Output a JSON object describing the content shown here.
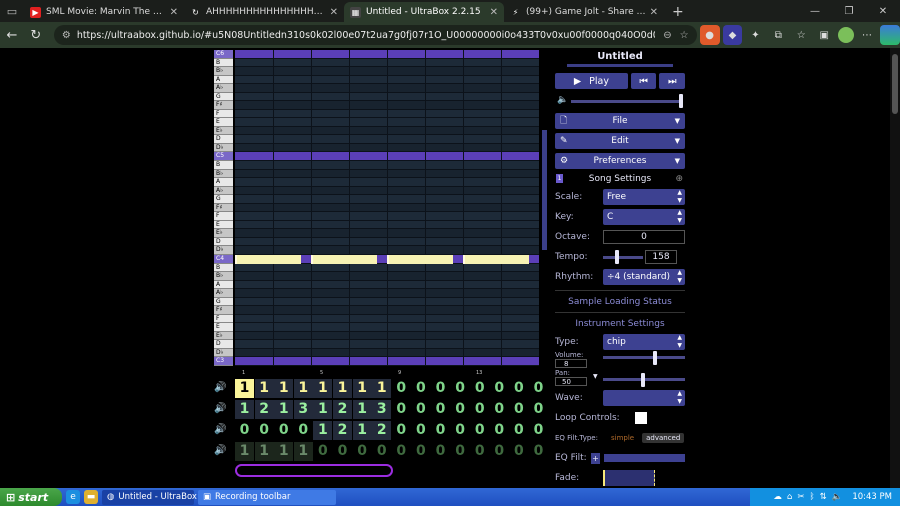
{
  "browser": {
    "tabs": [
      {
        "title": "SML Movie: Marvin The Hero! - Y",
        "fav_color": "#e02020",
        "fav_glyph": "▶",
        "active": false
      },
      {
        "title": "AHHHHHHHHHHHHHHHHHHHHH",
        "fav_color": "#1b1e1b",
        "fav_glyph": "↻",
        "active": false
      },
      {
        "title": "Untitled - UltraBox 2.2.15",
        "fav_color": "#444",
        "fav_glyph": "▦",
        "active": true
      },
      {
        "title": "(99+) Game Jolt - Share your cre",
        "fav_color": "#1b1e1b",
        "fav_glyph": "⚡",
        "active": false
      }
    ],
    "url": "https://ultraabox.github.io/#u5N08Untitledn310s0k02l00e07t2ua7g0fj07r1O_U00000000i0o433T0v0xu00f0000q040O0d030wp1h0y00..."
  },
  "song": {
    "title": "Untitled",
    "play_label": "Play",
    "menus": {
      "file": "File",
      "edit": "Edit",
      "preferences": "Preferences"
    },
    "song_settings_label": "Song Settings",
    "scale_label": "Scale:",
    "scale_value": "Free",
    "key_label": "Key:",
    "key_value": "C",
    "octave_label": "Octave:",
    "octave_value": "0",
    "tempo_label": "Tempo:",
    "tempo_value": "158",
    "rhythm_label": "Rhythm:",
    "rhythm_value": "÷4 (standard)",
    "sample_status": "Sample Loading Status",
    "instrument_settings": "Instrument Settings",
    "type_label": "Type:",
    "type_value": "chip",
    "volume_label": "Volume:",
    "volume_value": "8",
    "pan_label": "Pan:",
    "pan_value": "50",
    "wave_label": "Wave:",
    "loop_label": "Loop Controls:",
    "eq_type_label": "EQ Filt.Type:",
    "eq_simple": "simple",
    "eq_advanced": "advanced",
    "eq_filt_label": "EQ Filt:",
    "fade_label": "Fade:"
  },
  "piano_keys": [
    "C6",
    "B",
    "B♭",
    "A",
    "A♭",
    "G",
    "F♯",
    "F",
    "E",
    "E♭",
    "D",
    "D♭",
    "C5",
    "B",
    "B♭",
    "A",
    "A♭",
    "G",
    "F♯",
    "F",
    "E",
    "E♭",
    "D",
    "D♭",
    "C4",
    "B",
    "B♭",
    "A",
    "A♭",
    "G",
    "F♯",
    "F",
    "E",
    "E♭",
    "D",
    "D♭",
    "C3"
  ],
  "bar_numbers": [
    "1",
    "",
    "",
    "",
    "5",
    "",
    "",
    "",
    "9",
    "",
    "",
    "",
    "13"
  ],
  "tracks": [
    {
      "cells": [
        "1",
        "1",
        "1",
        "1",
        "1",
        "1",
        "1",
        "1",
        "0",
        "0",
        "0",
        "0",
        "0",
        "0",
        "0",
        "0"
      ],
      "color": "#fbf59a",
      "selected": 0
    },
    {
      "cells": [
        "1",
        "2",
        "1",
        "3",
        "1",
        "2",
        "1",
        "3",
        "0",
        "0",
        "0",
        "0",
        "0",
        "0",
        "0",
        "0"
      ],
      "color": "#9bf0a0"
    },
    {
      "cells": [
        "0",
        "0",
        "0",
        "0",
        "1",
        "2",
        "1",
        "2",
        "0",
        "0",
        "0",
        "0",
        "0",
        "0",
        "0",
        "0"
      ],
      "color": "#9bf0a0"
    },
    {
      "cells": [
        "1",
        "1",
        "1",
        "1",
        "0",
        "0",
        "0",
        "0",
        "0",
        "0",
        "0",
        "0",
        "0",
        "0",
        "0",
        "0"
      ],
      "color": "#6a8a6a"
    }
  ],
  "taskbar": {
    "start": "start",
    "items": [
      "Untitled - UltraBox 2.2....",
      "Recording toolbar"
    ],
    "time": "10:43 PM"
  }
}
